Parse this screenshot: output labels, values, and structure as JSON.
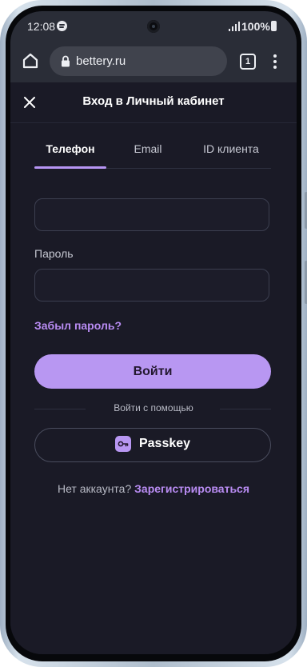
{
  "status_bar": {
    "time": "12:08",
    "battery": "100%",
    "icons": [
      "spotify-icon",
      "camera",
      "signal-icon",
      "battery-icon"
    ]
  },
  "browser": {
    "url": "bettery.ru",
    "tab_count": "1",
    "icons": [
      "home-icon",
      "lock-icon",
      "tabs-icon",
      "kebab-menu-icon"
    ]
  },
  "modal": {
    "title": "Вход в Личный кабинет",
    "close_icon": "close-icon"
  },
  "tabs": [
    {
      "label": "Телефон",
      "active": true
    },
    {
      "label": "Email",
      "active": false
    },
    {
      "label": "ID клиента",
      "active": false
    }
  ],
  "form": {
    "phone_value": "",
    "password_label": "Пароль",
    "password_value": "",
    "forgot_password": "Забыл пароль?",
    "login_button": "Войти",
    "divider_text": "Войти с помощью",
    "passkey_button": "Passkey",
    "passkey_icon": "key-icon"
  },
  "signup": {
    "question": "Нет аккаунта?",
    "link": "Зарегистрироваться"
  },
  "colors": {
    "background": "#1a1a26",
    "accent": "#b897f2",
    "browser_bar": "#2a2d37"
  }
}
